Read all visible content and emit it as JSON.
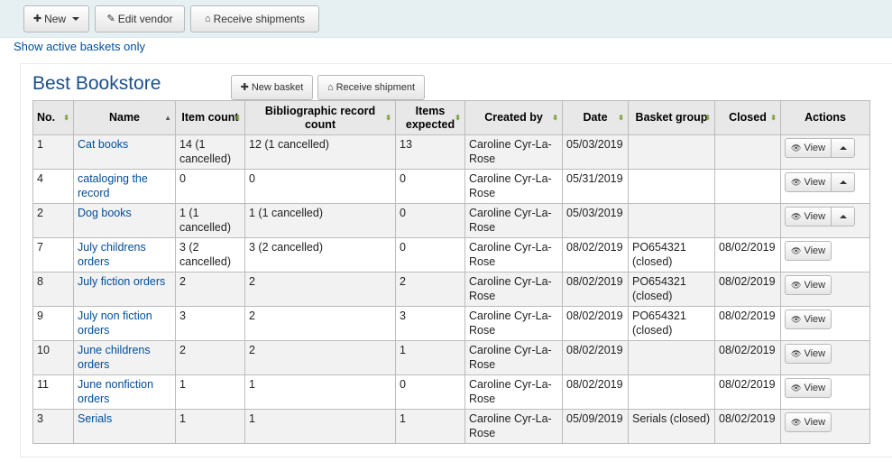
{
  "toolbar": {
    "new_label": "New",
    "edit_vendor_label": "Edit vendor",
    "receive_shipments_label": "Receive shipments"
  },
  "show_active_link": "Show active baskets only",
  "vendor_name": "Best Bookstore",
  "panel_buttons": {
    "new_basket": "New basket",
    "receive_shipment": "Receive shipment"
  },
  "columns": [
    "No.",
    "Name",
    "Item count",
    "Bibliographic record count",
    "Items expected",
    "Created by",
    "Date",
    "Basket group",
    "Closed",
    "Actions"
  ],
  "view_label": "View",
  "rows": [
    {
      "no": "1",
      "name": "Cat books",
      "item_count": "14 (1 cancelled)",
      "biblio_count": "12 (1 cancelled)",
      "expected": "13",
      "created_by": "Caroline Cyr-La-Rose",
      "date": "05/03/2019",
      "group": "",
      "closed": "",
      "dropdown": true
    },
    {
      "no": "4",
      "name": "cataloging the record",
      "item_count": "0",
      "biblio_count": "0",
      "expected": "0",
      "created_by": "Caroline Cyr-La-Rose",
      "date": "05/31/2019",
      "group": "",
      "closed": "",
      "dropdown": true
    },
    {
      "no": "2",
      "name": "Dog books",
      "item_count": "1 (1 cancelled)",
      "biblio_count": "1 (1 cancelled)",
      "expected": "0",
      "created_by": "Caroline Cyr-La-Rose",
      "date": "05/03/2019",
      "group": "",
      "closed": "",
      "dropdown": true
    },
    {
      "no": "7",
      "name": "July childrens orders",
      "item_count": "3 (2 cancelled)",
      "biblio_count": "3 (2 cancelled)",
      "expected": "0",
      "created_by": "Caroline Cyr-La-Rose",
      "date": "08/02/2019",
      "group": "PO654321 (closed)",
      "closed": "08/02/2019",
      "dropdown": false
    },
    {
      "no": "8",
      "name": "July fiction orders",
      "item_count": "2",
      "biblio_count": "2",
      "expected": "2",
      "created_by": "Caroline Cyr-La-Rose",
      "date": "08/02/2019",
      "group": "PO654321 (closed)",
      "closed": "08/02/2019",
      "dropdown": false
    },
    {
      "no": "9",
      "name": "July non fiction orders",
      "item_count": "3",
      "biblio_count": "2",
      "expected": "3",
      "created_by": "Caroline Cyr-La-Rose",
      "date": "08/02/2019",
      "group": "PO654321 (closed)",
      "closed": "08/02/2019",
      "dropdown": false
    },
    {
      "no": "10",
      "name": "June childrens orders",
      "item_count": "2",
      "biblio_count": "2",
      "expected": "1",
      "created_by": "Caroline Cyr-La-Rose",
      "date": "08/02/2019",
      "group": "",
      "closed": "08/02/2019",
      "dropdown": false
    },
    {
      "no": "11",
      "name": "June nonfiction orders",
      "item_count": "1",
      "biblio_count": "1",
      "expected": "0",
      "created_by": "Caroline Cyr-La-Rose",
      "date": "08/02/2019",
      "group": "",
      "closed": "08/02/2019",
      "dropdown": false
    },
    {
      "no": "3",
      "name": "Serials",
      "item_count": "1",
      "biblio_count": "1",
      "expected": "1",
      "created_by": "Caroline Cyr-La-Rose",
      "date": "05/09/2019",
      "group": "Serials (closed)",
      "closed": "08/02/2019",
      "dropdown": false
    }
  ]
}
